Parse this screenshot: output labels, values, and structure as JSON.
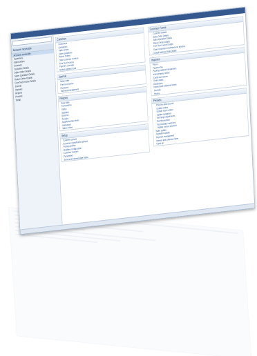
{
  "nav": {
    "header": "Accounts receivable",
    "search_placeholder": "",
    "items": [
      "Accounts receivable",
      "Customers",
      "Sales orders",
      "Common",
      "Customer Details",
      "Sales Order Details",
      "Sales Quotation Details",
      "Return Order Details",
      "Free Text Invoice Details",
      "Journal",
      "Inquiries",
      "Reports",
      "Periodic",
      "Setup"
    ]
  },
  "groups": {
    "common": {
      "title": "Common",
      "items": [
        "Customers",
        "Quotations",
        "Sales orders",
        "Sales quotations",
        "Return Orders",
        "Open customer invoices",
        "Free Text Invoices",
        "Payment Journals",
        "Global address book"
      ]
    },
    "journal": {
      "title": "Journal",
      "items": [
        "Sales order",
        "Free text invoice",
        "Payments",
        "Payment management"
      ]
    },
    "reports": {
      "title": "Reports",
      "items": [
        "Base data",
        "Transactions",
        "Status",
        "Statistics",
        "External",
        "Periodic",
        "Supplementary items",
        "Settlement",
        "Sales orders"
      ]
    },
    "setup": {
      "title": "Setup",
      "items": [
        "Customer groups",
        "Customer classification groups",
        "Posting profiles",
        "Modifiers configuration",
        "Customer reasons",
        "Parameters",
        "Service all Interest Rate Notes"
      ]
    },
    "common_forms": {
      "title": "Common Forms",
      "items": [
        "Customer Details",
        "Sales Order Details",
        "Sales Quotation Details",
        "Return Order Details",
        "Free Text Invoice Details",
        "Open customer enrollment and process",
        "Global Address Book Details"
      ]
    },
    "inquiries": {
      "title": "Inquiries",
      "items": [
        "Prices",
        "Payment fee",
        "Packing material transactions",
        "Intercompany orders",
        "Credit card issues",
        "Order status",
        "Distribution",
        "Interest and collection letters",
        "Journals",
        "History"
      ]
    },
    "periodic": {
      "title": "Periodic",
      "items": [
        "Post the sales journal",
        "Update orders",
        "Update return orders",
        "Update quotations",
        "Exchange adjustments",
        "Reimbursement",
        "Reconciliate credit limit",
        "Update invoice payment",
        "Sales update",
        "Quotation update",
        "Payment management",
        "Interest and collection letter",
        "Clean up"
      ]
    }
  }
}
